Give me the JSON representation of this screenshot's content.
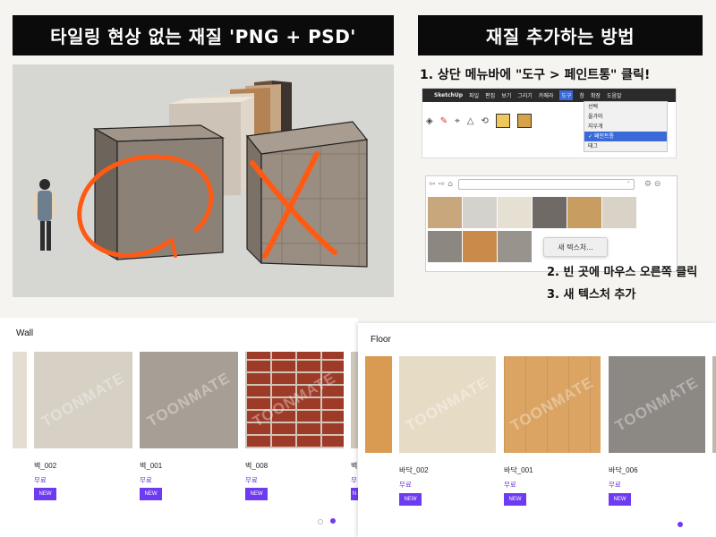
{
  "left_banner": {
    "title": "타일링 현상 없는 재질 'PNG + PSD'"
  },
  "right_banner": {
    "title": "재질 추가하는 방법"
  },
  "steps": {
    "step1": "1. 상단 메뉴바에 \"도구 > 페인트통\" 클릭!",
    "step2": "2. 빈 곳에 마우스 오른쪽 클릭",
    "step3": "3. 새 텍스처 추가"
  },
  "sketchup": {
    "menu": [
      "SketchUp",
      "파일",
      "편집",
      "보기",
      "그리기",
      "카메라",
      "도구",
      "창",
      "확장",
      "도움말"
    ],
    "tools_menu": [
      "선택",
      "올가미",
      "지우개",
      "✓ 페인트통",
      "태그"
    ],
    "new_texture_label": "새 텍스처..."
  },
  "wall_panel": {
    "title": "Wall",
    "cards": [
      {
        "name": "벽_002",
        "price": "무료",
        "badge": "NEW"
      },
      {
        "name": "벽_001",
        "price": "무료",
        "badge": "NEW"
      },
      {
        "name": "벽_008",
        "price": "무료",
        "badge": "NEW"
      },
      {
        "name": "벽",
        "price": "무",
        "badge": "N"
      }
    ],
    "watermark": "TOONMATE"
  },
  "floor_panel": {
    "title": "Floor",
    "cards": [
      {
        "name": "바닥_002",
        "price": "무료",
        "badge": "NEW"
      },
      {
        "name": "바닥_001",
        "price": "무료",
        "badge": "NEW"
      },
      {
        "name": "바닥_006",
        "price": "무료",
        "badge": "NEW"
      }
    ],
    "watermark": "TOONMATE"
  },
  "colors": {
    "accent": "#6e3cf0",
    "price": "#6a3cd6",
    "banner_bg": "#0b0b0b",
    "annotation": "#ff5a14"
  },
  "icons": [
    "apple-icon",
    "eraser-icon",
    "pencil-icon",
    "paint-bucket-icon",
    "back-arrow-icon",
    "forward-arrow-icon",
    "home-icon",
    "gear-icon",
    "dropdown-chevron-icon"
  ]
}
